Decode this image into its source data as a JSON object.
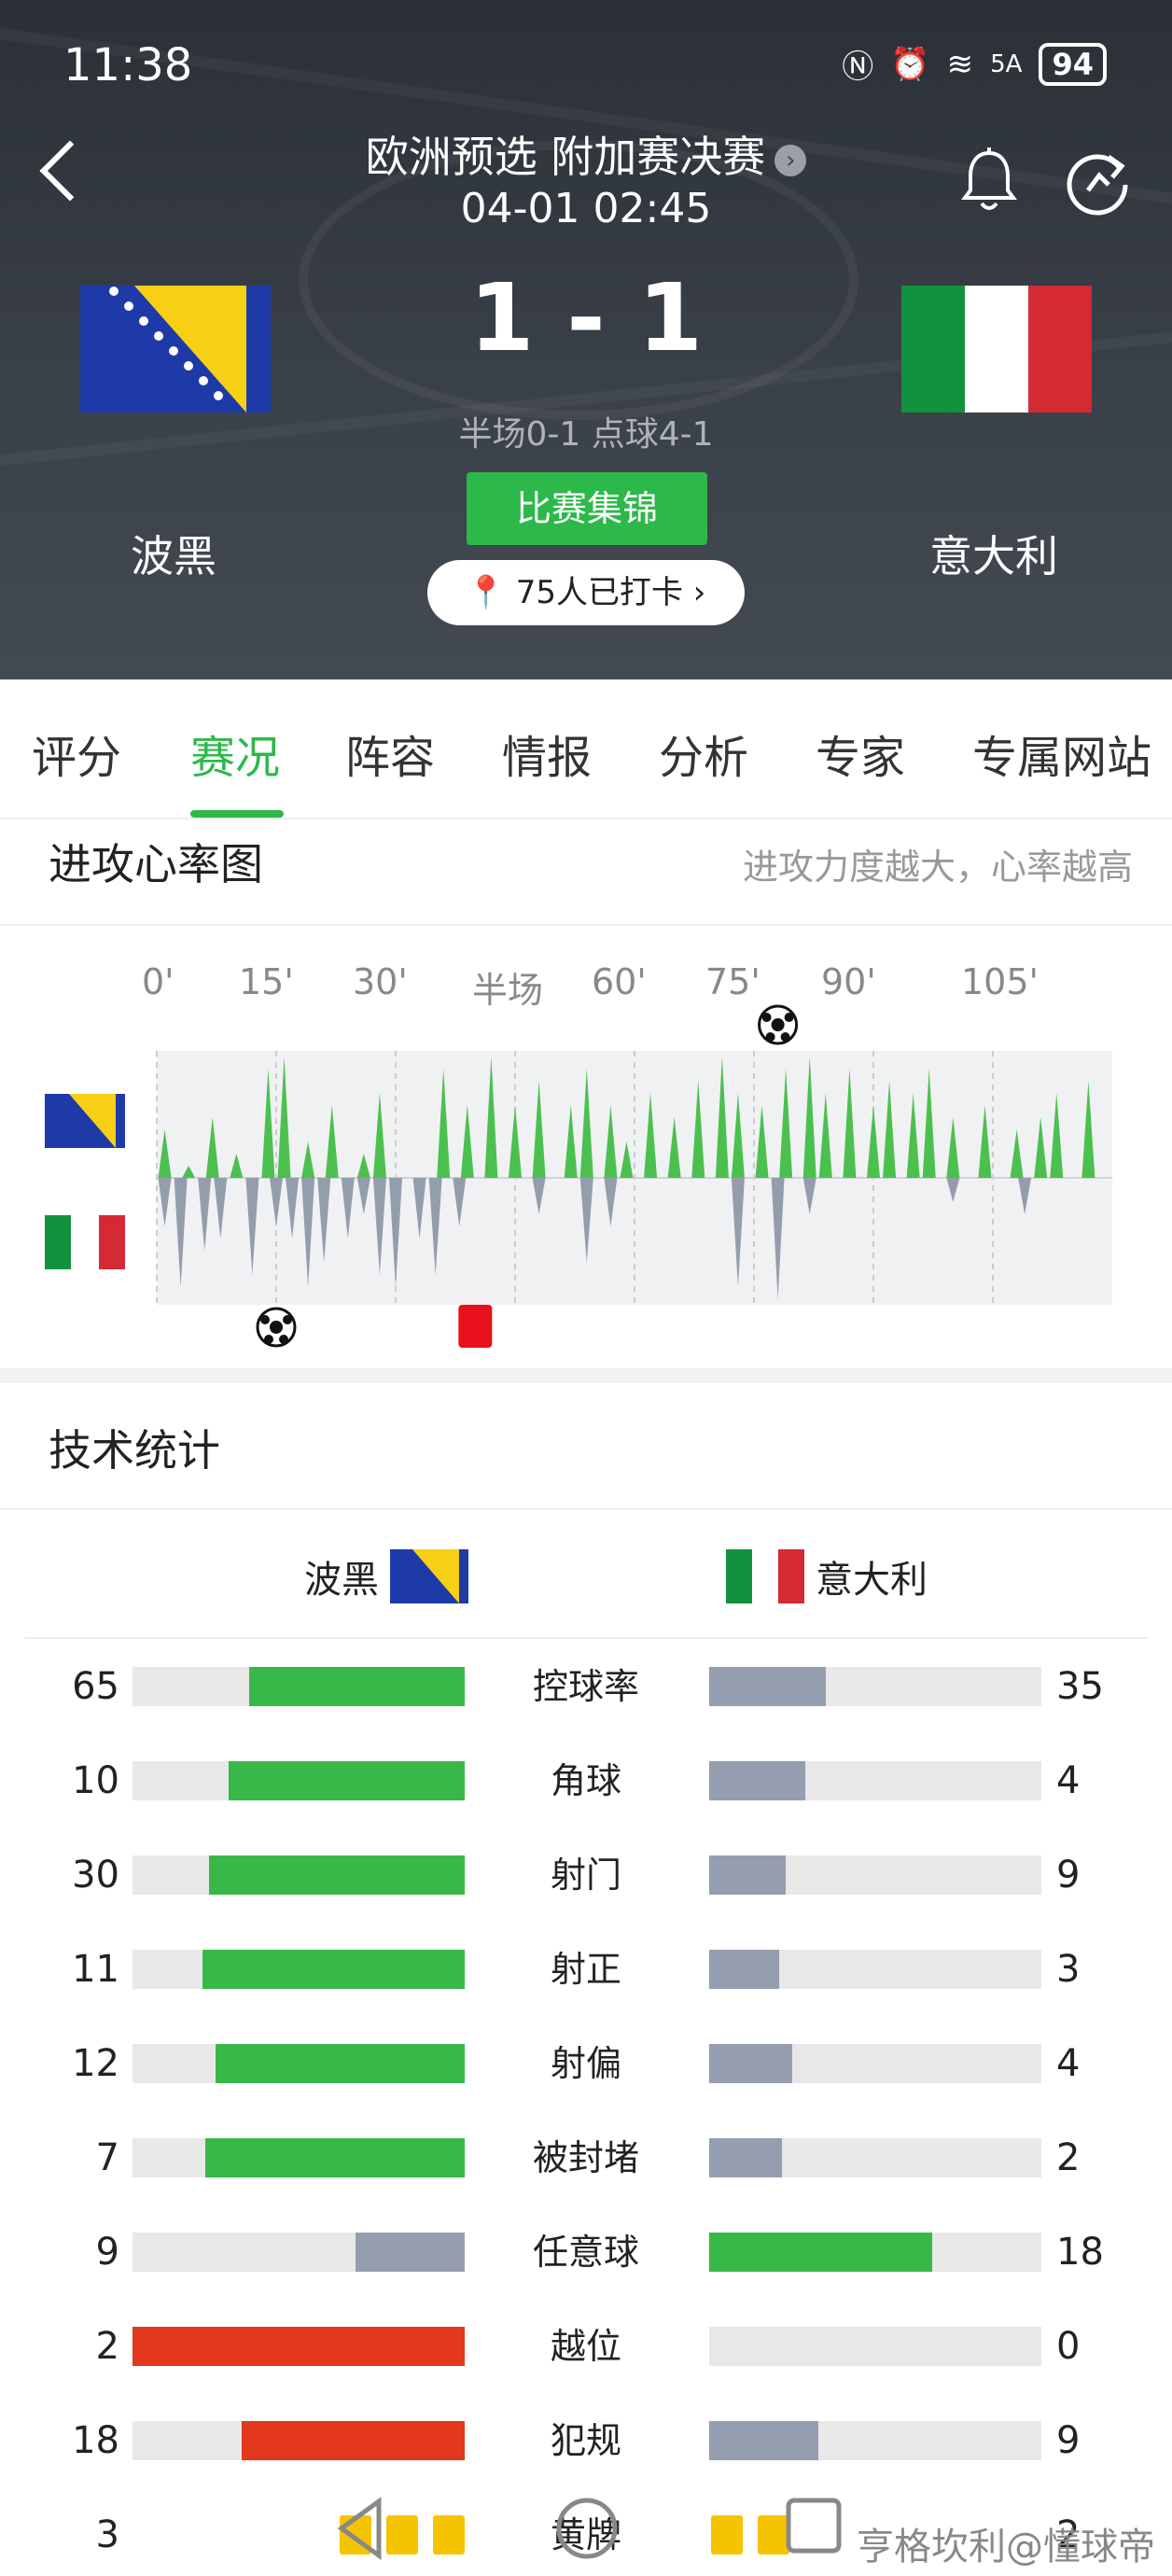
{
  "status": {
    "time": "11:38",
    "battery": "94",
    "signal": "5A"
  },
  "header": {
    "title": "欧洲预选 附加赛决赛",
    "title_more": "›",
    "datetime": "04-01 02:45",
    "score": "1 - 1",
    "halftime": "半场0-1 点球4-1",
    "home_team": "波黑",
    "away_team": "意大利",
    "highlights_label": "比赛集锦",
    "checkin_label": "75人已打卡 ›"
  },
  "tabs": [
    "评分",
    "赛况",
    "阵容",
    "情报",
    "分析",
    "专家",
    "专属网站"
  ],
  "active_tab": 1,
  "heart_chart": {
    "title": "进攻心率图",
    "note": "进攻力度越大，心率越高",
    "ticks": [
      "0'",
      "15'",
      "30'",
      "半场",
      "60'",
      "75'",
      "90'",
      "105'"
    ],
    "colors": {
      "home": "#4cc04f",
      "away": "#949dac"
    }
  },
  "chart_data": {
    "type": "area",
    "title": "进攻心率图",
    "x_ticks": [
      "0'",
      "15'",
      "30'",
      "半场",
      "60'",
      "75'",
      "90'",
      "105'"
    ],
    "xlim": [
      0,
      120
    ],
    "ylim": [
      -1,
      1
    ],
    "series": [
      {
        "name": "波黑",
        "values": [
          [
            1,
            0.4
          ],
          [
            4,
            0.1
          ],
          [
            7,
            0.5
          ],
          [
            10,
            0.2
          ],
          [
            14,
            0.9
          ],
          [
            16,
            1.0
          ],
          [
            19,
            0.3
          ],
          [
            22,
            0.6
          ],
          [
            26,
            0.2
          ],
          [
            28,
            0.7
          ],
          [
            36,
            0.9
          ],
          [
            39,
            0.6
          ],
          [
            42,
            1.0
          ],
          [
            45,
            0.6
          ],
          [
            48,
            0.8
          ],
          [
            52,
            0.6
          ],
          [
            54,
            0.9
          ],
          [
            57,
            0.6
          ],
          [
            59,
            0.3
          ],
          [
            62,
            0.7
          ],
          [
            65,
            0.5
          ],
          [
            68,
            0.8
          ],
          [
            71,
            1.0
          ],
          [
            73,
            0.7
          ],
          [
            76,
            0.6
          ],
          [
            79,
            0.9
          ],
          [
            82,
            1.0
          ],
          [
            84,
            0.7
          ],
          [
            87,
            0.9
          ],
          [
            90,
            0.6
          ],
          [
            92,
            0.8
          ],
          [
            95,
            0.7
          ],
          [
            97,
            0.9
          ],
          [
            100,
            0.5
          ],
          [
            104,
            0.6
          ],
          [
            108,
            0.4
          ],
          [
            111,
            0.5
          ],
          [
            113,
            0.7
          ],
          [
            117,
            0.8
          ]
        ]
      },
      {
        "name": "意大利",
        "values": [
          [
            1,
            -0.4
          ],
          [
            3,
            -0.9
          ],
          [
            6,
            -0.6
          ],
          [
            8,
            -0.5
          ],
          [
            12,
            -0.8
          ],
          [
            15,
            -0.4
          ],
          [
            17,
            -0.5
          ],
          [
            19,
            -0.9
          ],
          [
            21,
            -0.7
          ],
          [
            24,
            -0.5
          ],
          [
            26,
            -0.3
          ],
          [
            28,
            -0.8
          ],
          [
            30,
            -0.9
          ],
          [
            33,
            -0.5
          ],
          [
            35,
            -0.8
          ],
          [
            38,
            -0.4
          ],
          [
            48,
            -0.3
          ],
          [
            54,
            -0.7
          ],
          [
            57,
            -0.4
          ],
          [
            73,
            -0.9
          ],
          [
            78,
            -1.0
          ],
          [
            82,
            -0.3
          ],
          [
            100,
            -0.2
          ],
          [
            109,
            -0.3
          ]
        ]
      }
    ],
    "events": [
      {
        "team": "波黑",
        "type": "goal",
        "minute": 78
      },
      {
        "team": "意大利",
        "type": "goal",
        "minute": 15
      },
      {
        "team": "意大利",
        "type": "red-card",
        "minute": 40
      }
    ]
  },
  "stats": {
    "title": "技术统计",
    "home": "波黑",
    "away": "意大利",
    "rows": [
      {
        "label": "控球率",
        "home": "65",
        "away": "35",
        "hw": 0.65,
        "aw": 0.35,
        "hc": "#39b84a",
        "ac": "#959eae"
      },
      {
        "label": "角球",
        "home": "10",
        "away": "4",
        "hw": 0.71,
        "aw": 0.29,
        "hc": "#39b84a",
        "ac": "#959eae"
      },
      {
        "label": "射门",
        "home": "30",
        "away": "9",
        "hw": 0.77,
        "aw": 0.23,
        "hc": "#39b84a",
        "ac": "#959eae"
      },
      {
        "label": "射正",
        "home": "11",
        "away": "3",
        "hw": 0.79,
        "aw": 0.21,
        "hc": "#39b84a",
        "ac": "#959eae"
      },
      {
        "label": "射偏",
        "home": "12",
        "away": "4",
        "hw": 0.75,
        "aw": 0.25,
        "hc": "#39b84a",
        "ac": "#959eae"
      },
      {
        "label": "被封堵",
        "home": "7",
        "away": "2",
        "hw": 0.78,
        "aw": 0.22,
        "hc": "#39b84a",
        "ac": "#959eae"
      },
      {
        "label": "任意球",
        "home": "9",
        "away": "18",
        "hw": 0.33,
        "aw": 0.67,
        "hc": "#959eae",
        "ac": "#39b84a"
      },
      {
        "label": "越位",
        "home": "2",
        "away": "0",
        "hw": 1.0,
        "aw": 0.0,
        "hc": "#e2391e",
        "ac": "#959eae"
      },
      {
        "label": "犯规",
        "home": "18",
        "away": "9",
        "hw": 0.67,
        "aw": 0.33,
        "hc": "#e2391e",
        "ac": "#959eae"
      },
      {
        "label": "黄牌",
        "home": "3",
        "away": "2",
        "cards": true
      }
    ]
  },
  "watermark": "亨格坎利@懂球帝"
}
